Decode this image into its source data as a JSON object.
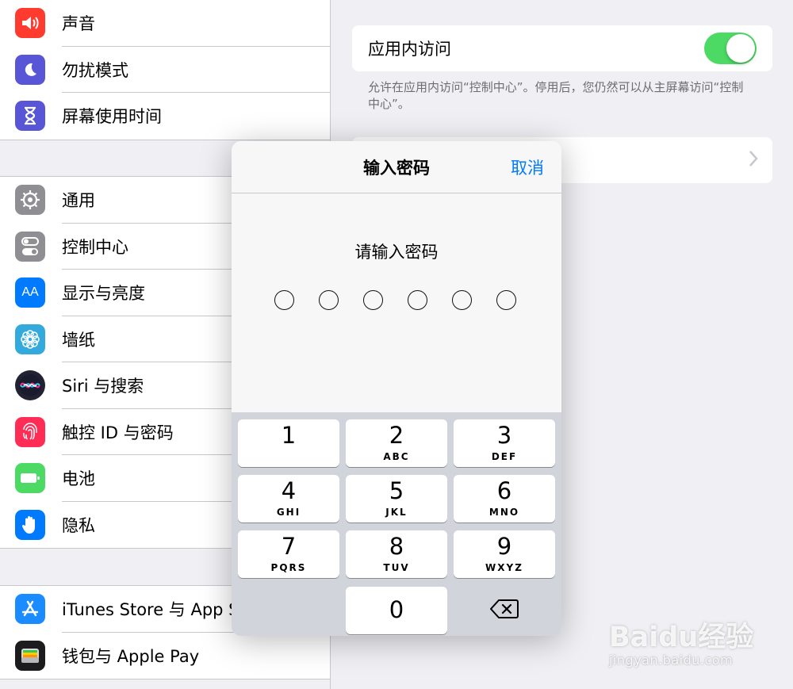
{
  "sidebar": {
    "group1": [
      {
        "label": "声音",
        "icon": "speaker-icon",
        "color": "#ff3b30"
      },
      {
        "label": "勿扰模式",
        "icon": "moon-icon",
        "color": "#5856d6"
      },
      {
        "label": "屏幕使用时间",
        "icon": "hourglass-icon",
        "color": "#5856d6"
      }
    ],
    "group2": [
      {
        "label": "通用",
        "icon": "gear-icon",
        "color": "#8e8e93"
      },
      {
        "label": "控制中心",
        "icon": "toggles-icon",
        "color": "#8e8e93"
      },
      {
        "label": "显示与亮度",
        "icon": "text-size-icon",
        "glyph": "AA",
        "color": "#007aff"
      },
      {
        "label": "墙纸",
        "icon": "flower-icon",
        "color": "#34aadc"
      },
      {
        "label": "Siri 与搜索",
        "icon": "siri-icon",
        "color": "#222233"
      },
      {
        "label": "触控 ID 与密码",
        "icon": "fingerprint-icon",
        "color": "#ff2d55"
      },
      {
        "label": "电池",
        "icon": "battery-icon",
        "color": "#4cd964"
      },
      {
        "label": "隐私",
        "icon": "hand-icon",
        "color": "#007aff"
      }
    ],
    "group3": [
      {
        "label": "iTunes Store 与 App Store",
        "icon": "app-store-icon",
        "color": "#1a8cff"
      },
      {
        "label": "钱包与 Apple Pay",
        "icon": "wallet-icon",
        "color": "#1c1c1e"
      }
    ]
  },
  "detail": {
    "access_label": "应用内访问",
    "access_on": true,
    "footnote": "允许在应用内访问“控制中心”。停用后，您仍然可以从主屏幕访问“控制中心”。",
    "accent": "#4cd964"
  },
  "modal": {
    "title": "输入密码",
    "cancel": "取消",
    "prompt": "请输入密码",
    "digits_total": 6,
    "keys": [
      {
        "num": "1",
        "sub": ""
      },
      {
        "num": "2",
        "sub": "ABC"
      },
      {
        "num": "3",
        "sub": "DEF"
      },
      {
        "num": "4",
        "sub": "GHI"
      },
      {
        "num": "5",
        "sub": "JKL"
      },
      {
        "num": "6",
        "sub": "MNO"
      },
      {
        "num": "7",
        "sub": "PQRS"
      },
      {
        "num": "8",
        "sub": "TUV"
      },
      {
        "num": "9",
        "sub": "WXYZ"
      },
      {
        "num": "0",
        "sub": ""
      }
    ],
    "delete_icon": "backspace-icon",
    "link_color": "#007aff"
  },
  "watermark": {
    "brand": "Baidu经验",
    "url": "jingyan.baidu.com"
  }
}
